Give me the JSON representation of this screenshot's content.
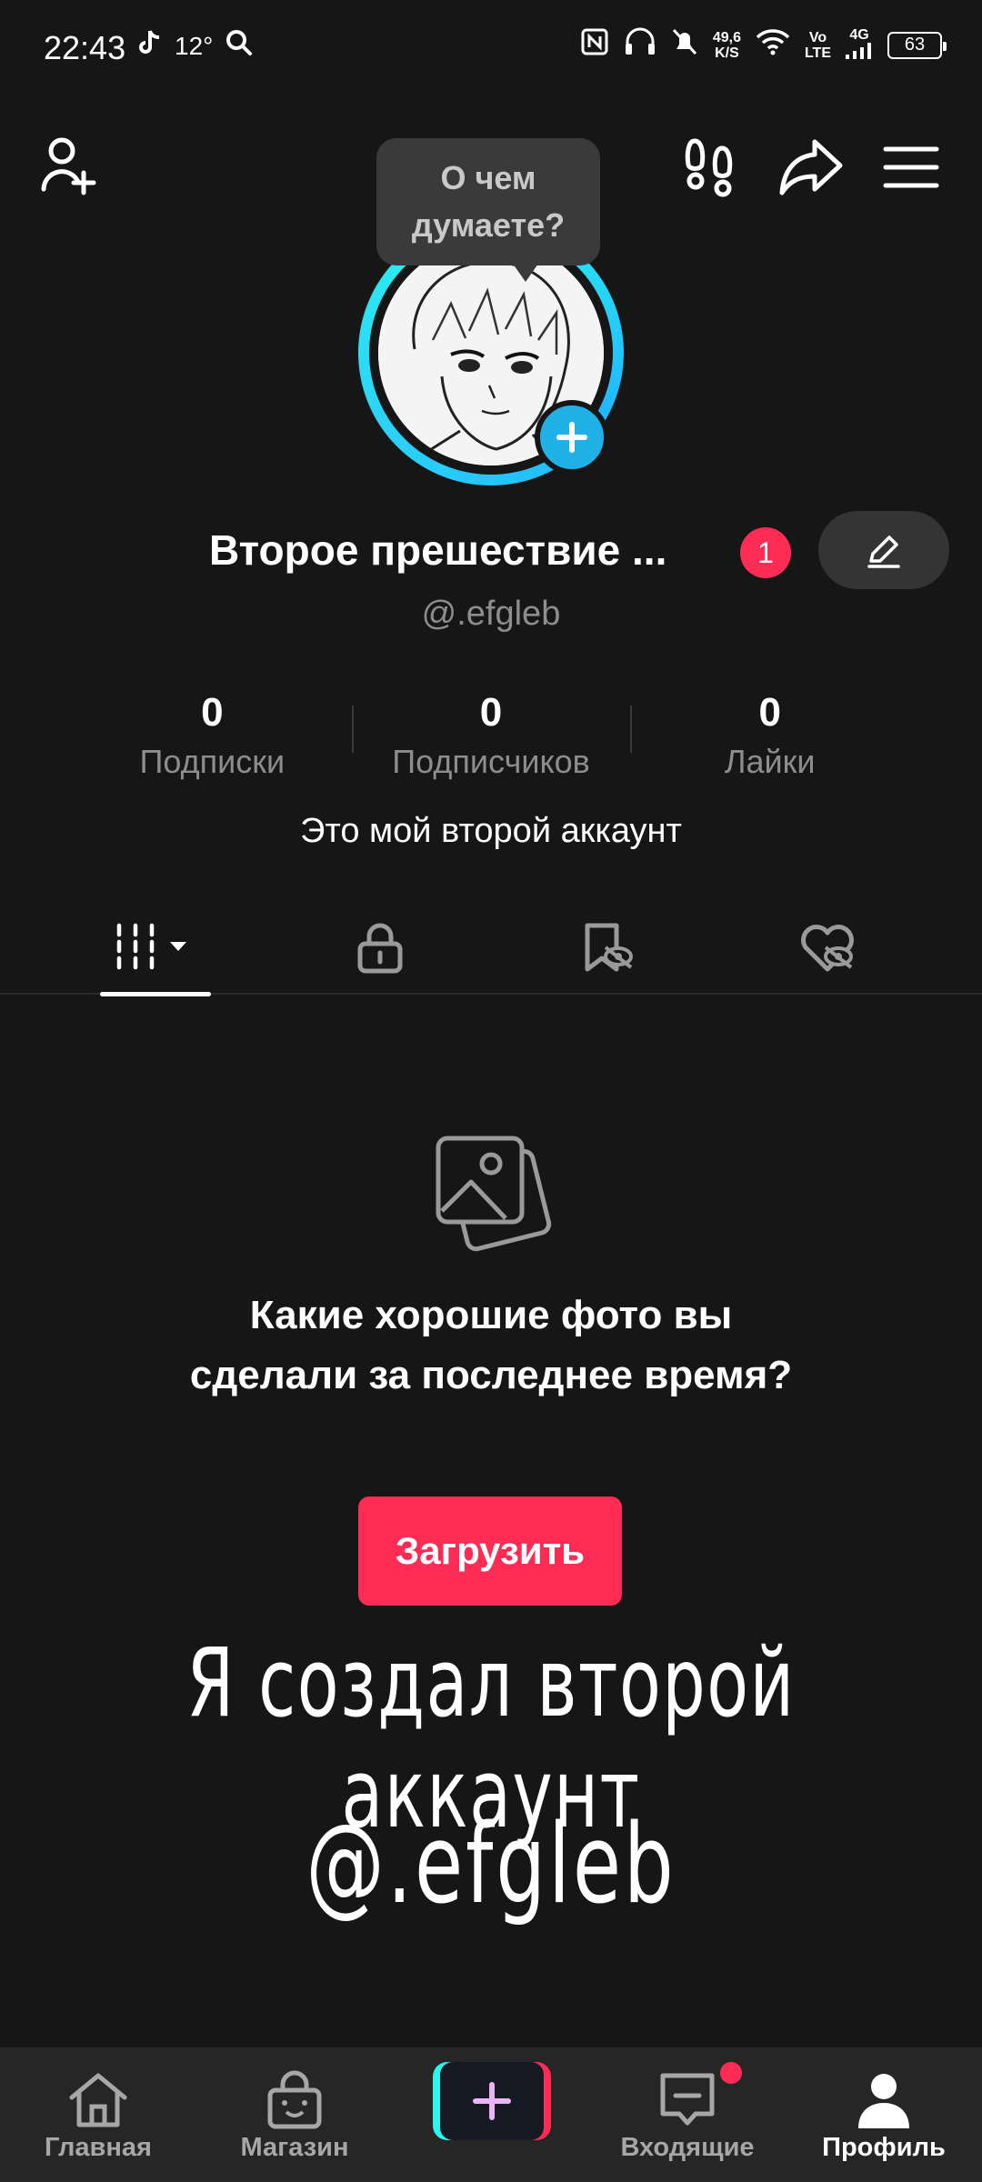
{
  "status_bar": {
    "time": "22:43",
    "temperature": "12°",
    "speed_value": "49,6",
    "speed_unit": "K/S",
    "volte_top": "Vo",
    "volte_bottom": "LTE",
    "network": "4G",
    "battery": "63",
    "icons": [
      "tiktok-icon",
      "search-icon",
      "nfc-icon",
      "headphones-icon",
      "mute-icon",
      "wifi-icon",
      "signal-icon",
      "battery-icon"
    ]
  },
  "top_nav": {
    "icons": [
      "add-friend-icon",
      "footprints-icon",
      "share-icon",
      "menu-icon"
    ]
  },
  "bubble": {
    "text_line1": "О чем",
    "text_line2": "думаете?"
  },
  "profile": {
    "name": "Второе прешествие ...",
    "notification_count": "1",
    "handle": "@.efgleb",
    "bio": "Это мой второй аккаунт",
    "accent_ring": "#2cf4ef",
    "plus_color": "#20b1e6"
  },
  "stats": [
    {
      "value": "0",
      "label": "Подписки"
    },
    {
      "value": "0",
      "label": "Подписчиков"
    },
    {
      "value": "0",
      "label": "Лайки"
    }
  ],
  "tabs": {
    "active": "posts",
    "icons": [
      "grid-icon",
      "lock-icon",
      "saved-hidden-icon",
      "liked-hidden-icon"
    ]
  },
  "empty_state": {
    "title": "Какие хорошие фото вы сделали за последнее время?",
    "button": "Загрузить",
    "icon": "photos-icon"
  },
  "overlay": {
    "line1": "Я создал второй аккаунт",
    "line2": "@.efgleb"
  },
  "bottom_nav": {
    "home": "Главная",
    "shop": "Магазин",
    "inbox": "Входящие",
    "profile": "Профиль",
    "active": "profile"
  },
  "colors": {
    "background": "#161616",
    "accent_red": "#fe2c55",
    "accent_cyan": "#2cf4ef"
  }
}
